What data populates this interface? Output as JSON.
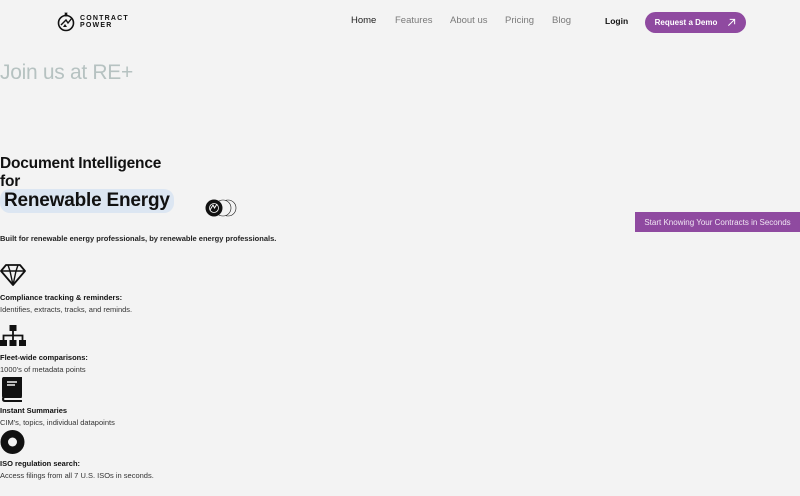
{
  "brand": {
    "line1": "CONTRACT",
    "line2": "POWER"
  },
  "nav": {
    "items": [
      {
        "label": "Home",
        "active": true
      },
      {
        "label": "Features",
        "active": false
      },
      {
        "label": "About us",
        "active": false
      },
      {
        "label": "Pricing",
        "active": false
      },
      {
        "label": "Blog",
        "active": false
      }
    ],
    "login": "Login",
    "demo": "Request a Demo"
  },
  "announcement": "Join us at RE+",
  "hero": {
    "line1": "Document Intelligence",
    "line2": "for",
    "highlight": "Renewable Energy",
    "tagline": "Built for renewable energy professionals, by renewable energy professionals.",
    "cta": "Start Knowing Your Contracts in Seconds"
  },
  "features": [
    {
      "icon": "diamond-icon",
      "title": "Compliance tracking & reminders:",
      "desc": "Identifies, extracts, tracks, and reminds."
    },
    {
      "icon": "sitemap-icon",
      "title": "Fleet-wide comparisons:",
      "desc": "1000's of metadata points"
    },
    {
      "icon": "book-icon",
      "title": "Instant Summaries",
      "desc": "CIM's, topics, individual datapoints"
    },
    {
      "icon": "record-icon",
      "title": "ISO regulation search:",
      "desc": "Access filings from all 7 U.S. ISOs in seconds."
    }
  ],
  "colors": {
    "accent": "#8f4aa0",
    "highlight_bg": "#dce6f2",
    "announcement": "#b6c2c1",
    "background": "#f3f3f3"
  }
}
